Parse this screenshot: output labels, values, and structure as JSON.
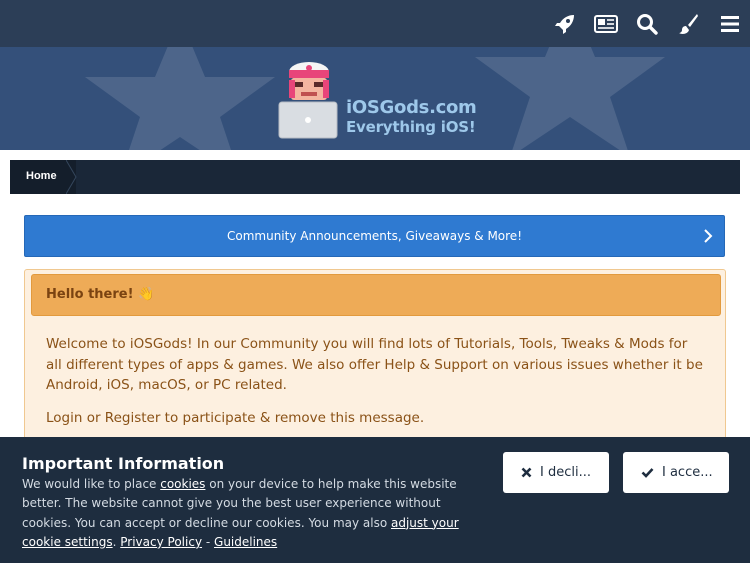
{
  "nav": {
    "icons": [
      "rocket-icon",
      "newspaper-icon",
      "search-icon",
      "paintbrush-icon",
      "menu-icon"
    ]
  },
  "logo": {
    "line1": "iOSGods.com",
    "line2": "Everything iOS!"
  },
  "breadcrumb": {
    "home": "Home"
  },
  "announcement": {
    "text": "Community Announcements, Giveaways & More!"
  },
  "notice": {
    "title": "Hello there! 👋",
    "body": "Welcome to iOSGods! In our Community you will find lots of Tutorials, Tools, Tweaks & Mods for all different types of apps & games. We also offer Help & Support on various issues whether it be Android, iOS, macOS, or PC related.",
    "login_line": "Login or Register to participate & remove this message."
  },
  "cookie": {
    "title": "Important Information",
    "text_a": "We would like to place ",
    "link_cookies": "cookies",
    "text_b": " on your device to help make this website better. The website cannot give you the best user experience without cookies. You can accept or decline our cookies. You may also ",
    "link_adjust": "adjust your cookie settings",
    "text_c": ". ",
    "link_privacy": "Privacy Policy",
    "text_d": " - ",
    "link_guidelines": "Guidelines",
    "decline_label": "I decli...",
    "accept_label": "I acce..."
  },
  "colors": {
    "nav_bg": "#2c3e57",
    "banner_bg": "#34507a",
    "announce_bg": "#2f7ad1",
    "notice_head": "#eeab57",
    "cookie_bg": "#1e2d3f"
  }
}
